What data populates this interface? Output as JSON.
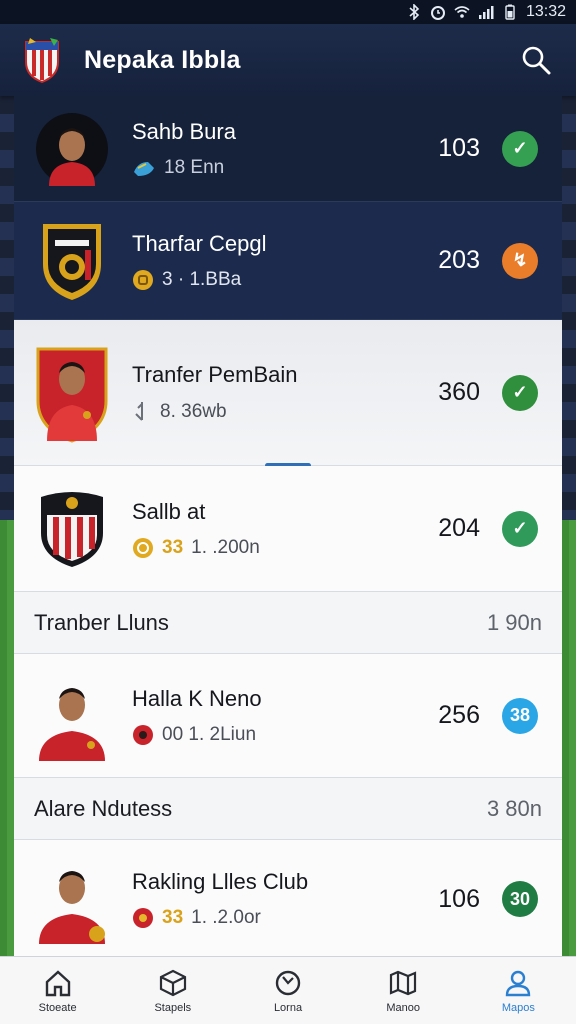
{
  "status_bar": {
    "time": "13:32"
  },
  "app": {
    "title": "Nepaka Ibbla"
  },
  "rows": [
    {
      "name": "Sahb Bura",
      "meta_text": "18 Enn",
      "meta_hi": "",
      "number": "103",
      "badge": "✓",
      "badge_color": "#35a052"
    },
    {
      "name": "Tharfar Cepgl",
      "meta_text": "3 · 1.BBa",
      "meta_hi": "",
      "number": "203",
      "badge": "↯",
      "badge_color": "#ea7d2a"
    },
    {
      "name": "Tranfer PemBain",
      "meta_text": "8. 36wb",
      "meta_hi": "",
      "number": "360",
      "badge": "✓",
      "badge_color": "#2f8f3d"
    },
    {
      "name": "Sallb at",
      "meta_text": "1. .200n",
      "meta_hi": "33",
      "number": "204",
      "badge": "✓",
      "badge_color": "#2f9a5a"
    },
    {
      "name": "Halla K Neno",
      "meta_text": "00 1. 2Liun",
      "meta_hi": "",
      "number": "256",
      "badge": "38",
      "badge_color": "#2aa6e6"
    },
    {
      "name": "Rakling Llles Club",
      "meta_text": "1. .2.0or",
      "meta_hi": "33",
      "number": "106",
      "badge": "30",
      "badge_color": "#1f7d43"
    }
  ],
  "sections": [
    {
      "label": "Tranber Lluns",
      "value": "1 90n"
    },
    {
      "label": "Alare Ndutess",
      "value": "3 80n"
    }
  ],
  "nav": [
    {
      "label": "Stoeate",
      "icon": "home-icon"
    },
    {
      "label": "Stapels",
      "icon": "cube-icon"
    },
    {
      "label": "Lorna",
      "icon": "refresh-icon"
    },
    {
      "label": "Manoo",
      "icon": "map-icon"
    },
    {
      "label": "Mapos",
      "icon": "person-icon"
    }
  ],
  "colors": {
    "accent": "#2b7fd0",
    "app_bar": "#1d2b4a",
    "drag_handle": "#2e6fb8"
  }
}
